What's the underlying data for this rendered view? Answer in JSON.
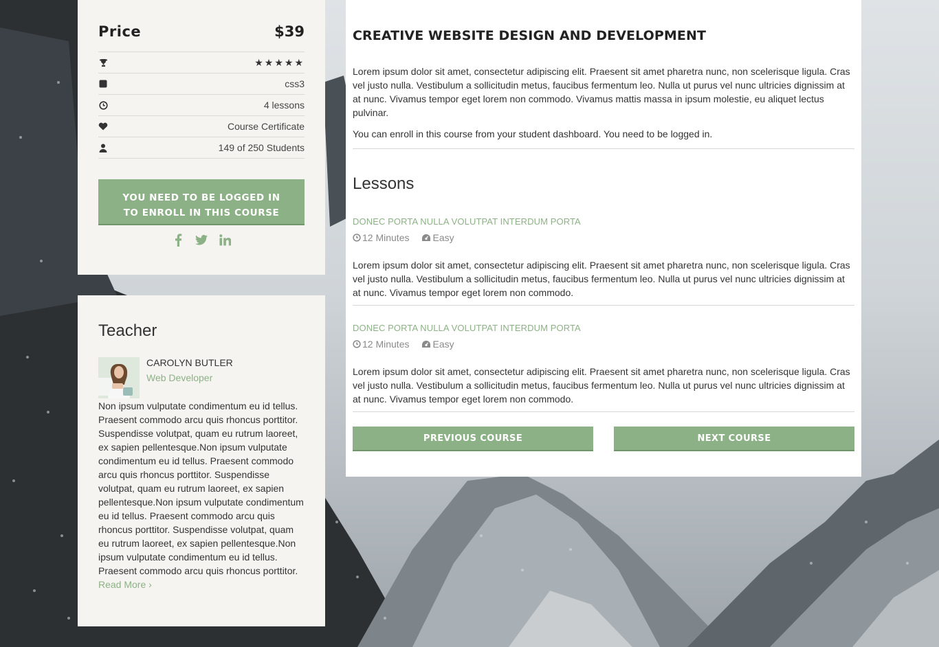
{
  "colors": {
    "accent": "#8db186",
    "card_bg": "#f5f4f0",
    "main_bg": "#ffffff",
    "text": "#333333"
  },
  "price_card": {
    "price_label": "Price",
    "price_value": "$39",
    "rows": [
      {
        "icon": "trophy-icon",
        "value": "★★★★★",
        "rating": 5
      },
      {
        "icon": "square-icon",
        "value": "css3"
      },
      {
        "icon": "clock-icon",
        "value": "4 lessons"
      },
      {
        "icon": "heart-icon",
        "value": "Course Certificate"
      },
      {
        "icon": "user-icon",
        "value": "149 of 250 Students"
      }
    ],
    "enroll_line1": "YOU NEED TO BE LOGGED IN",
    "enroll_line2": "TO ENROLL IN THIS COURSE",
    "social": [
      "facebook-icon",
      "twitter-icon",
      "linkedin-icon"
    ]
  },
  "teacher": {
    "heading": "Teacher",
    "name": "CAROLYN BUTLER",
    "role": "Web Developer",
    "bio": "Non ipsum vulputate condimentum eu id tellus. Praesent commodo arcu quis rhoncus porttitor. Suspendisse volutpat, quam eu rutrum laoreet, ex sapien pellentesque.Non ipsum vulputate condimentum eu id tellus. Praesent commodo arcu quis rhoncus porttitor. Suspendisse volutpat, quam eu rutrum laoreet, ex sapien pellentesque.Non ipsum vulputate condimentum eu id tellus. Praesent commodo arcu quis rhoncus porttitor. Suspendisse volutpat, quam eu rutrum laoreet, ex sapien pellentesque.Non ipsum vulputate condimentum eu id tellus. Praesent commodo arcu quis rhoncus porttitor.",
    "read_more": "Read More ›"
  },
  "course": {
    "title": "CREATIVE WEBSITE DESIGN AND DEVELOPMENT",
    "description": "Lorem ipsum dolor sit amet, consectetur adipiscing elit. Praesent sit amet pharetra nunc, non scelerisque ligula. Cras vel justo nulla. Vestibulum a sollicitudin metus, faucibus fermentum leo. Nulla ut purus vel nunc ultricies dignissim at at nunc. Vivamus tempor eget lorem non commodo. Vivamus mattis massa in ipsum molestie, eu aliquet lectus pulvinar.",
    "enroll_note": "You can enroll in this course from your student dashboard. You need to be logged in."
  },
  "lessons": {
    "heading": "Lessons",
    "items": [
      {
        "title": "DONEC PORTA NULLA VOLUTPAT INTERDUM PORTA",
        "duration": "12 Minutes",
        "level": "Easy",
        "description": "Lorem ipsum dolor sit amet, consectetur adipiscing elit. Praesent sit amet pharetra nunc, non scelerisque ligula. Cras vel justo nulla. Vestibulum a sollicitudin metus, faucibus fermentum leo. Nulla ut purus vel nunc ultricies dignissim at at nunc. Vivamus tempor eget lorem non commodo."
      },
      {
        "title": "DONEC PORTA NULLA VOLUTPAT INTERDUM PORTA",
        "duration": "12 Minutes",
        "level": "Easy",
        "description": "Lorem ipsum dolor sit amet, consectetur adipiscing elit. Praesent sit amet pharetra nunc, non scelerisque ligula. Cras vel justo nulla. Vestibulum a sollicitudin metus, faucibus fermentum leo. Nulla ut purus vel nunc ultricies dignissim at at nunc. Vivamus tempor eget lorem non commodo."
      }
    ]
  },
  "navigation": {
    "previous": "PREVIOUS COURSE",
    "next": "NEXT COURSE"
  }
}
